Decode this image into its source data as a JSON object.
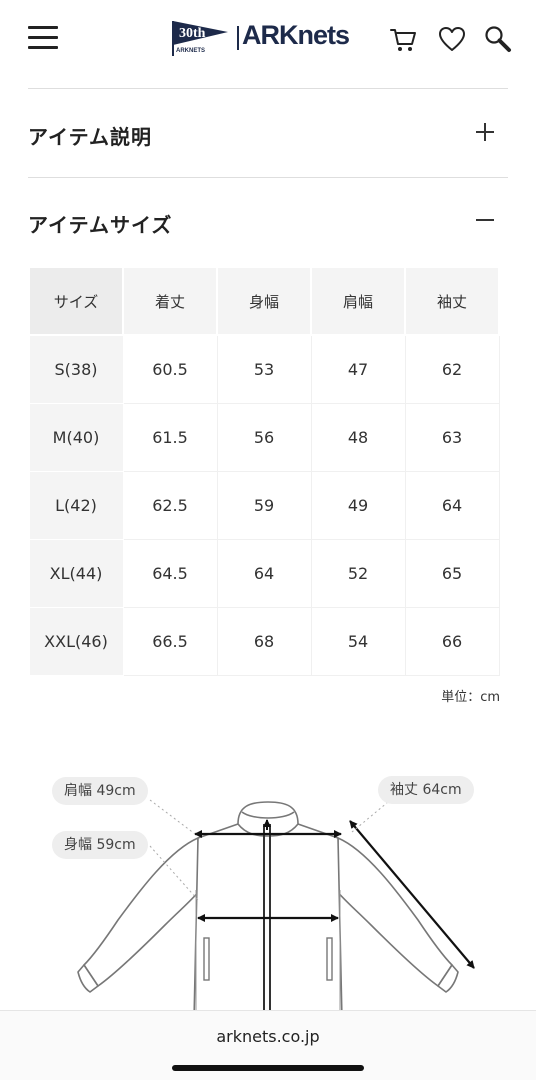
{
  "header": {
    "logo_badge": "30th",
    "logo_badge_sub": "ARKNETS",
    "logo_text": "ARKnets"
  },
  "sections": {
    "description": {
      "title": "アイテム説明"
    },
    "size": {
      "title": "アイテムサイズ"
    }
  },
  "size_table": {
    "headers": [
      "サイズ",
      "着丈",
      "身幅",
      "肩幅",
      "袖丈"
    ],
    "rows": [
      [
        "S(38)",
        "60.5",
        "53",
        "47",
        "62"
      ],
      [
        "M(40)",
        "61.5",
        "56",
        "48",
        "63"
      ],
      [
        "L(42)",
        "62.5",
        "59",
        "49",
        "64"
      ],
      [
        "XL(44)",
        "64.5",
        "64",
        "52",
        "65"
      ],
      [
        "XXL(46)",
        "66.5",
        "68",
        "54",
        "66"
      ]
    ],
    "unit": "単位：cm"
  },
  "diagram": {
    "shoulder_label": "肩幅 49cm",
    "chest_label": "身幅 59cm",
    "sleeve_label": "袖丈 64cm"
  },
  "browser": {
    "url": "arknets.co.jp"
  }
}
